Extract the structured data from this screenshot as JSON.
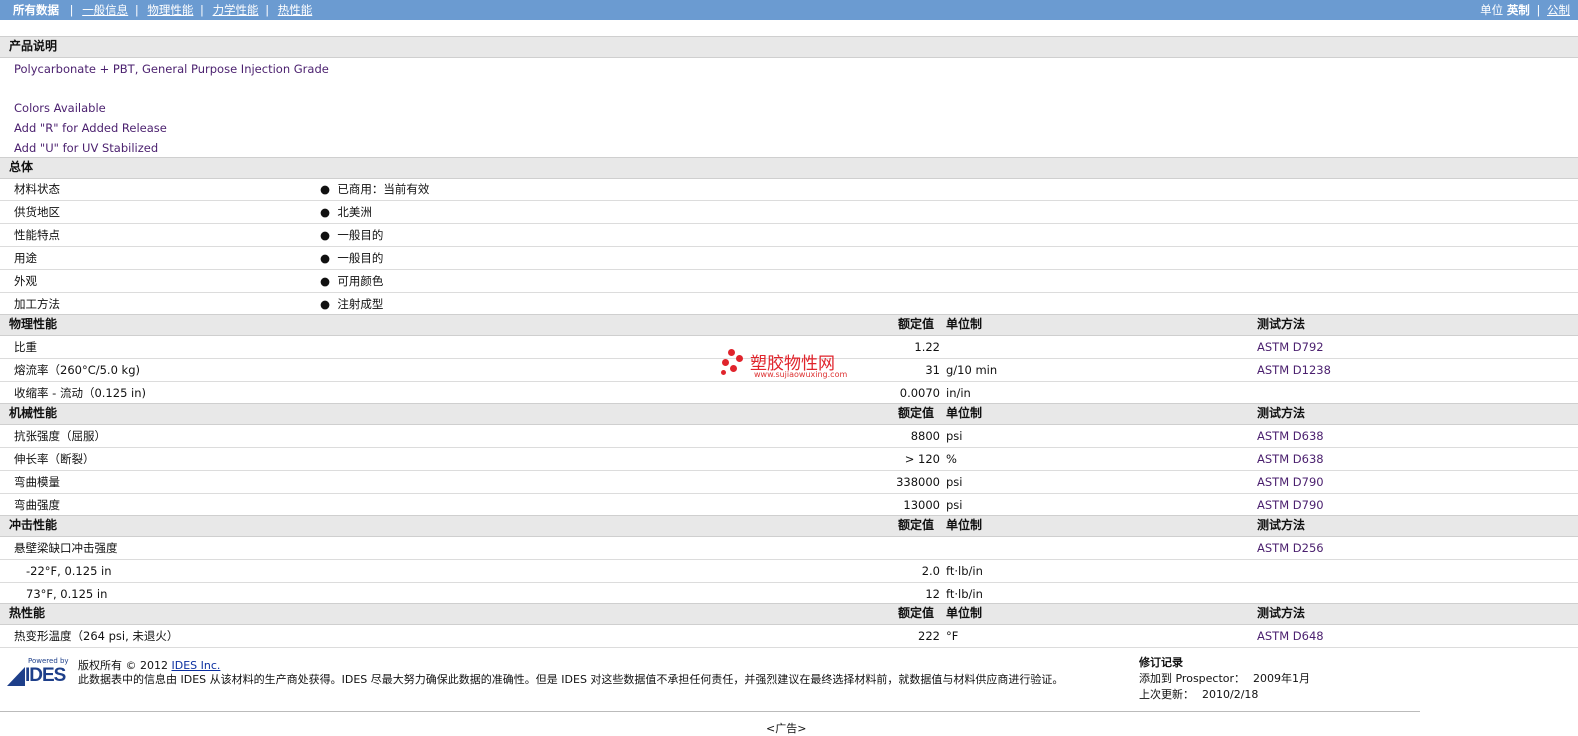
{
  "nav": {
    "tabs": [
      "所有数据",
      "一般信息",
      "物理性能",
      "力学性能",
      "热性能"
    ],
    "units_label": "单位",
    "unit_active": "英制",
    "unit_other": "公制"
  },
  "product": {
    "heading": "产品说明",
    "lines": [
      "Polycarbonate + PBT, General Purpose Injection Grade",
      "Colors Available",
      "Add \"R\" for Added Release",
      "Add \"U\" for UV Stabilized"
    ]
  },
  "general": {
    "heading": "总体",
    "rows": [
      {
        "label": "材料状态",
        "value": "已商用：当前有效"
      },
      {
        "label": "供货地区",
        "value": "北美洲"
      },
      {
        "label": "性能特点",
        "value": "一般目的"
      },
      {
        "label": "用途",
        "value": "一般目的"
      },
      {
        "label": "外观",
        "value": "可用颜色"
      },
      {
        "label": "加工方法",
        "value": "注射成型"
      }
    ]
  },
  "col_headers": {
    "nominal": "额定值",
    "unit": "单位制",
    "method": "测试方法"
  },
  "physical": {
    "heading": "物理性能",
    "rows": [
      {
        "label": "比重",
        "value": "1.22",
        "unit": "",
        "method": "ASTM D792"
      },
      {
        "label": "熔流率（260°C/5.0 kg)",
        "value": "31",
        "unit": "g/10 min",
        "method": "ASTM D1238"
      },
      {
        "label": "收缩率 - 流动（0.125 in)",
        "value": "0.0070",
        "unit": "in/in",
        "method": ""
      }
    ]
  },
  "mechanical": {
    "heading": "机械性能",
    "rows": [
      {
        "label": "抗张强度（屈服）",
        "value": "8800",
        "unit": "psi",
        "method": "ASTM D638"
      },
      {
        "label": "伸长率（断裂）",
        "value": "> 120",
        "unit": "%",
        "method": "ASTM D638"
      },
      {
        "label": "弯曲模量",
        "value": "338000",
        "unit": "psi",
        "method": "ASTM D790"
      },
      {
        "label": "弯曲强度",
        "value": "13000",
        "unit": "psi",
        "method": "ASTM D790"
      }
    ]
  },
  "impact": {
    "heading": "冲击性能",
    "rows": [
      {
        "label": "悬壁梁缺口冲击强度",
        "value": "",
        "unit": "",
        "method": "ASTM D256"
      },
      {
        "label": "-22°F, 0.125 in",
        "value": "2.0",
        "unit": "ft·lb/in",
        "method": ""
      },
      {
        "label": "73°F, 0.125 in",
        "value": "12",
        "unit": "ft·lb/in",
        "method": ""
      }
    ]
  },
  "thermal": {
    "heading": "热性能",
    "rows": [
      {
        "label": "热变形温度（264 psi, 未退火）",
        "value": "222",
        "unit": "°F",
        "method": "ASTM D648"
      }
    ]
  },
  "watermark": {
    "big": "塑胶物性网",
    "small": "www.sujiaowuxing.com",
    "color": "#e0242c"
  },
  "footer": {
    "logo_small": "Powered by",
    "logo_big": "IDES",
    "copyright_prefix": "版权所有 © 2012",
    "copyright_link": "IDES Inc.",
    "disclaimer": "此数据表中的信息由 IDES 从该材料的生产商处获得。IDES 尽最大努力确保此数据的准确性。但是 IDES 对这些数据值不承担任何责任，并强烈建议在最终选择材料前，就数据值与材料供应商进行验证。",
    "revision_heading": "修订记录",
    "added_label": "添加到 Prospector：",
    "added_value": "2009年1月",
    "updated_label": "上次更新：",
    "updated_value": "2010/2/18",
    "ad": "<广告>"
  },
  "colors": {
    "nav_bg": "#6b9bd1",
    "link_purple": "#4a1f6e",
    "header_bg": "#e8e8e8"
  }
}
